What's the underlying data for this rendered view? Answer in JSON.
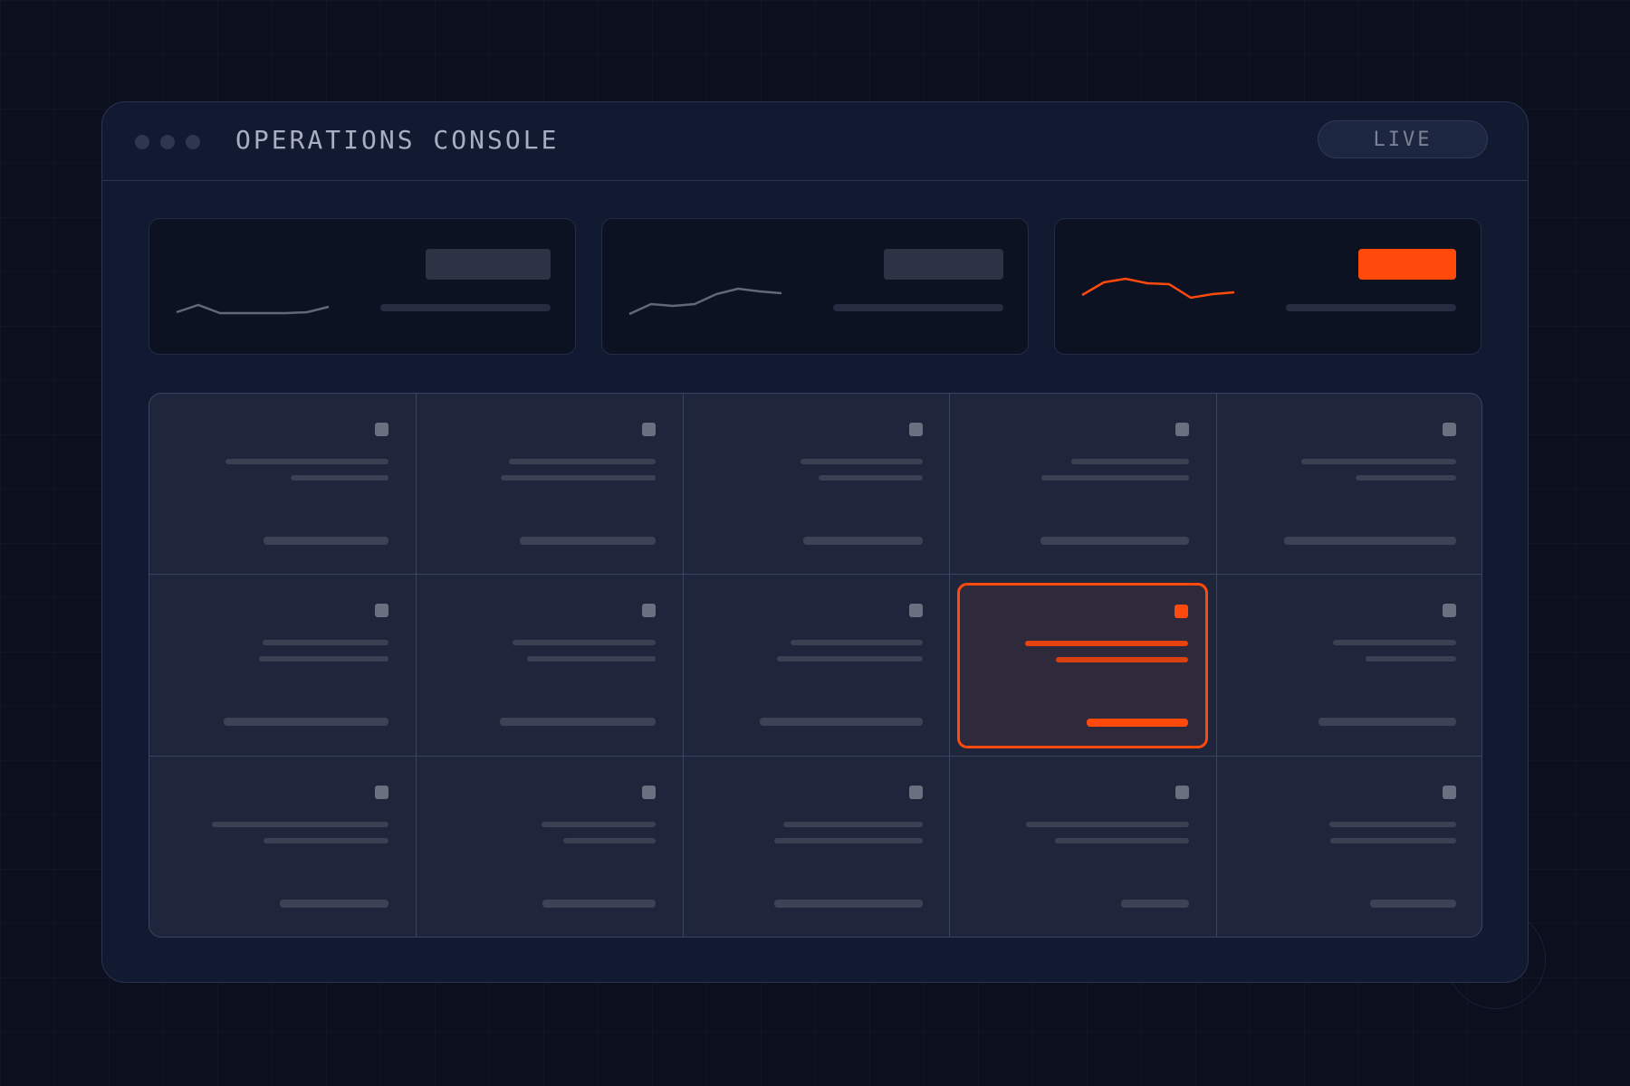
{
  "window": {
    "title": "OPERATIONS CONSOLE",
    "status_badge": "LIVE"
  },
  "colors": {
    "accent": "#ff4a0c",
    "background": "#0b0f1e",
    "panel": "#111a31",
    "tile": "#1f263c",
    "muted_line": "#6b7080"
  },
  "metric_cards": [
    {
      "name": "metric-card-1",
      "highlighted": false,
      "sparkline": [
        12,
        20,
        11,
        11,
        11,
        11,
        12,
        18
      ]
    },
    {
      "name": "metric-card-2",
      "highlighted": false,
      "sparkline": [
        10,
        21,
        19,
        21,
        32,
        38,
        35,
        33
      ]
    },
    {
      "name": "metric-card-3",
      "highlighted": true,
      "sparkline": [
        31,
        45,
        49,
        44,
        43,
        28,
        32,
        34
      ]
    }
  ],
  "tile_grid": {
    "rows": 3,
    "columns": 5,
    "selected_tile": {
      "row": 2,
      "column": 4
    }
  }
}
